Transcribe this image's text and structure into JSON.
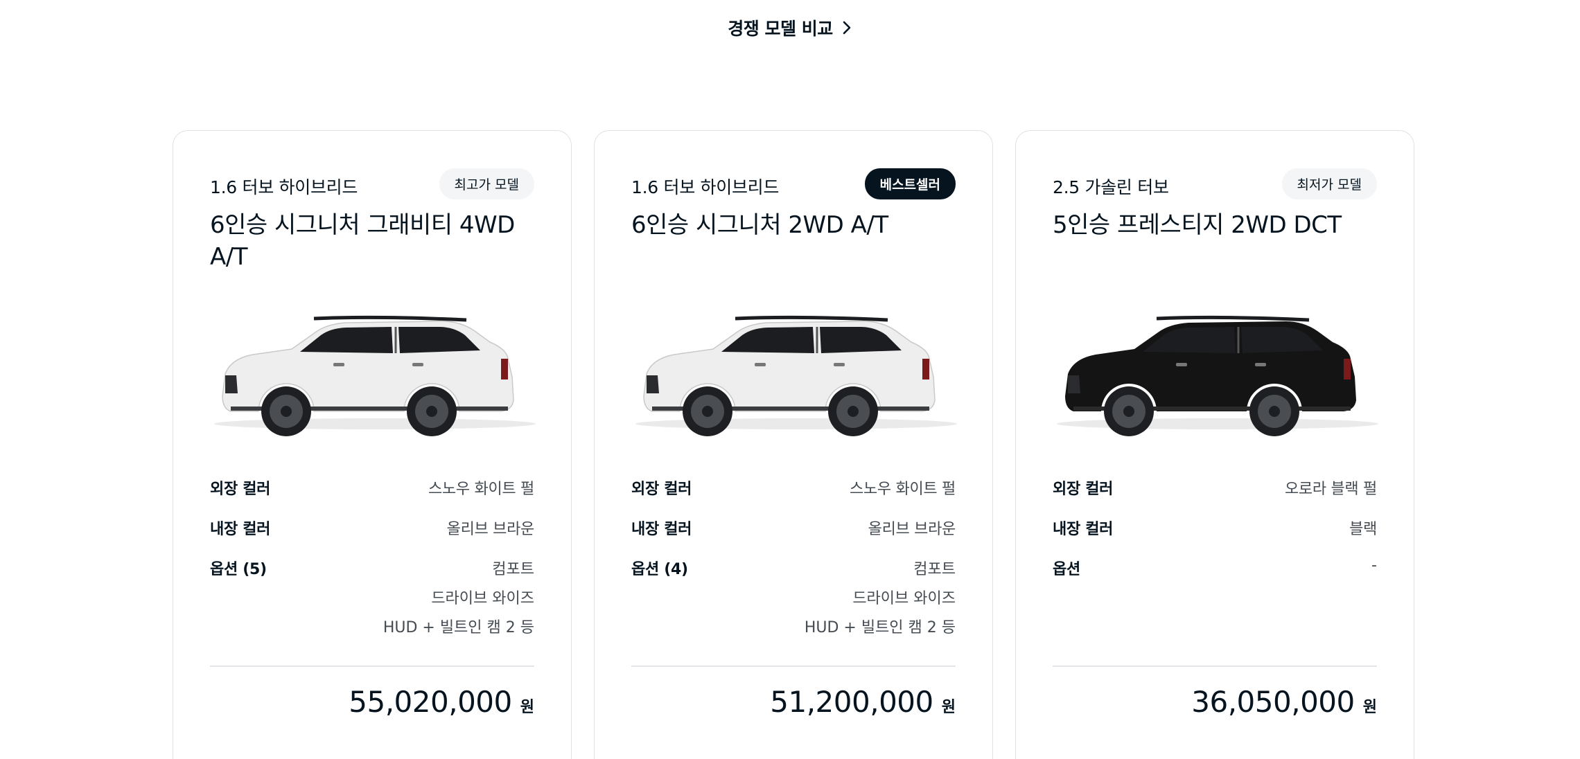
{
  "compare": {
    "label": "경쟁 모델 비교"
  },
  "cards": [
    {
      "engine": "1.6 터보 하이브리드",
      "badge": "최고가 모델",
      "badge_style": "light",
      "trim": "6인승 시그니처 그래비티 4WD A/T",
      "car_color": "white",
      "specs": {
        "exterior_label": "외장 컬러",
        "exterior_value": "스노우 화이트 펄",
        "interior_label": "내장 컬러",
        "interior_value": "올리브 브라운",
        "options_label": "옵션 (5)",
        "options": [
          "컴포트",
          "드라이브 와이즈",
          "HUD + 빌트인 캠 2 등"
        ]
      },
      "price": "55,020,000",
      "currency": "원"
    },
    {
      "engine": "1.6 터보 하이브리드",
      "badge": "베스트셀러",
      "badge_style": "dark",
      "trim": "6인승 시그니처 2WD A/T",
      "car_color": "white",
      "specs": {
        "exterior_label": "외장 컬러",
        "exterior_value": "스노우 화이트 펄",
        "interior_label": "내장 컬러",
        "interior_value": "올리브 브라운",
        "options_label": "옵션 (4)",
        "options": [
          "컴포트",
          "드라이브 와이즈",
          "HUD + 빌트인 캠 2 등"
        ]
      },
      "price": "51,200,000",
      "currency": "원"
    },
    {
      "engine": "2.5 가솔린 터보",
      "badge": "최저가 모델",
      "badge_style": "light",
      "trim": "5인승 프레스티지 2WD DCT",
      "car_color": "black",
      "specs": {
        "exterior_label": "외장 컬러",
        "exterior_value": "오로라 블랙 펄",
        "interior_label": "내장 컬러",
        "interior_value": "블랙",
        "options_label": "옵션",
        "options": [
          "-"
        ]
      },
      "price": "36,050,000",
      "currency": "원"
    }
  ],
  "colors": {
    "text": "#05141f",
    "border": "#dfe1e3",
    "badge_light": "#f4f5f6",
    "badge_dark": "#05141f",
    "car_white": "#eeeeee",
    "car_black": "#141414"
  }
}
